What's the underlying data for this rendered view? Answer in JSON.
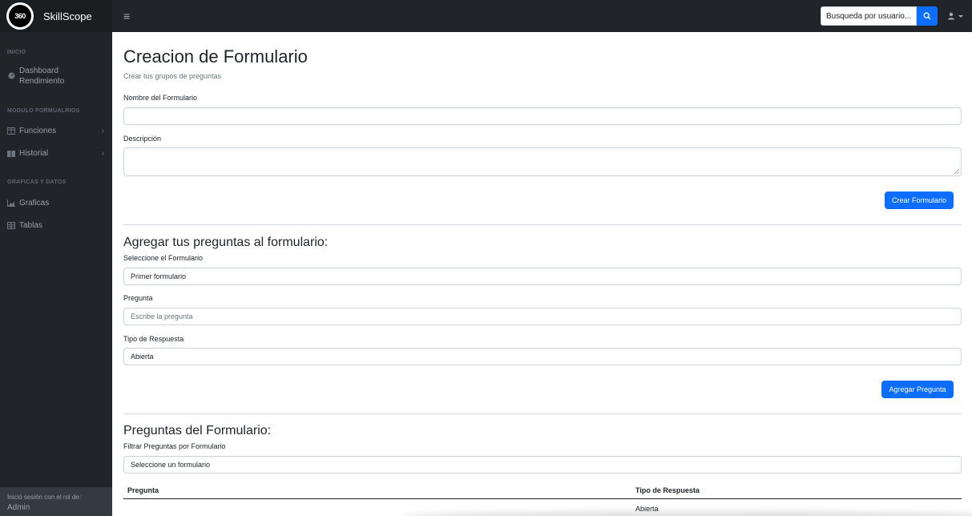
{
  "app": {
    "brand_logo_text": "360",
    "brand_name": "SkillScope"
  },
  "header": {
    "search_placeholder": "Busqueda por usuario..."
  },
  "sidebar": {
    "sections": [
      {
        "heading": "INICIO"
      },
      {
        "heading": "MODULO FORMUALRIOS"
      },
      {
        "heading": "GRAFICAS Y DATOS"
      }
    ],
    "items": [
      {
        "label_line1": "Dashboard",
        "label_line2": "Rendimiento",
        "icon": "gauge-icon"
      },
      {
        "label": "Funciones",
        "icon": "columns-icon",
        "has_chevron": true
      },
      {
        "label": "Historial",
        "icon": "book-icon",
        "has_chevron": true
      },
      {
        "label": "Graficas",
        "icon": "area-chart-icon"
      },
      {
        "label": "Tablas",
        "icon": "table-icon"
      }
    ],
    "footer": {
      "label": "Inició sesión con el rol de:",
      "role": "Admin"
    }
  },
  "create_form": {
    "title": "Creacion de Formulario",
    "subtitle": "Crear tus grupos de preguntas",
    "name_label": "Nombre del Formulario",
    "name_value": "",
    "description_label": "Descripción",
    "description_value": "",
    "submit_label": "Crear Formulario"
  },
  "add_question": {
    "title": "Agregar tus preguntas al formulario:",
    "form_select_label": "Seleccione el Formulario",
    "form_select_value": "Primer formulario",
    "question_label": "Pregunta",
    "question_placeholder": "Escribe la pregunta",
    "type_label": "Tipo de Respuesta",
    "type_value": "Abierta",
    "submit_label": "Agregar Pregunta"
  },
  "questions": {
    "title": "Preguntas del Formulario:",
    "filter_label": "Filtrar Preguntas por Formulario",
    "filter_value": "Seleccione un formulario",
    "columns": [
      "Pregunta",
      "Tipo de Respuesta"
    ],
    "rows": [
      {
        "question": "",
        "type": "Abierta"
      }
    ]
  },
  "colors": {
    "sidebar_bg": "#212529",
    "primary": "#0d6efd"
  }
}
